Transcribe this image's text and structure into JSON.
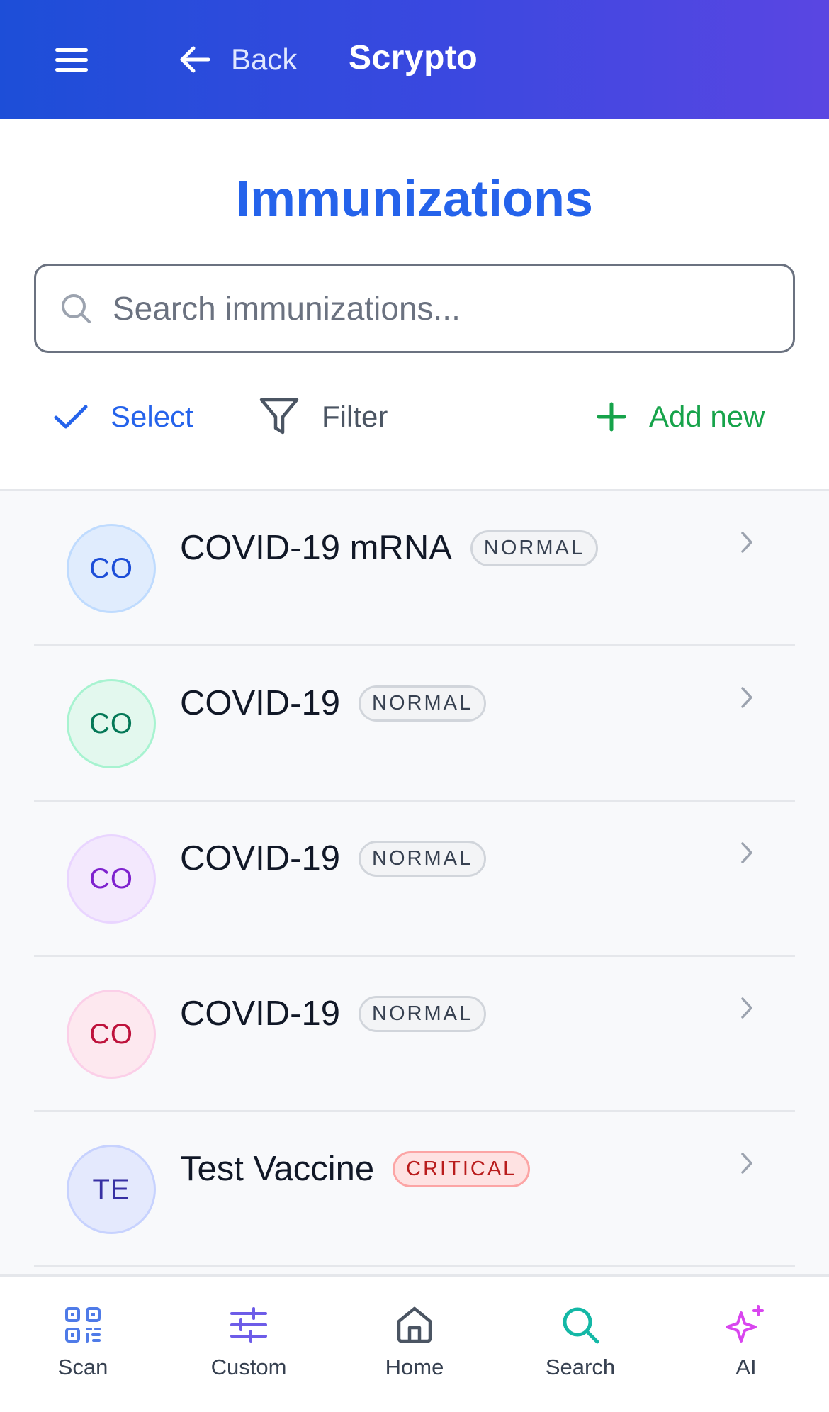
{
  "header": {
    "back_label": "Back",
    "app_title": "Scrypto"
  },
  "page": {
    "title": "Immunizations"
  },
  "search": {
    "placeholder": "Search immunizations..."
  },
  "toolbar": {
    "select_label": "Select",
    "filter_label": "Filter",
    "add_label": "Add new"
  },
  "colors": {
    "header_gradient_start": "#1d4ed8",
    "header_gradient_end": "#5a46e2",
    "title_blue": "#2563eb",
    "add_green": "#16a34a",
    "critical_red": "#b91c1c"
  },
  "immunizations": [
    {
      "initials": "CO",
      "name": "COVID-19 mRNA",
      "status": "NORMAL",
      "avatar_color": "#1d4ed8",
      "avatar_bg": "#e0ecfd",
      "avatar_border": "#bfdbfe"
    },
    {
      "initials": "CO",
      "name": "COVID-19",
      "status": "NORMAL",
      "avatar_color": "#047857",
      "avatar_bg": "#e3f8ee",
      "avatar_border": "#a7f3d0"
    },
    {
      "initials": "CO",
      "name": "COVID-19",
      "status": "NORMAL",
      "avatar_color": "#7e22ce",
      "avatar_bg": "#f3e8fd",
      "avatar_border": "#e9d5ff"
    },
    {
      "initials": "CO",
      "name": "COVID-19",
      "status": "NORMAL",
      "avatar_color": "#be123c",
      "avatar_bg": "#fde8ef",
      "avatar_border": "#fbcfe8"
    },
    {
      "initials": "TE",
      "name": "Test Vaccine",
      "status": "CRITICAL",
      "avatar_color": "#3730a3",
      "avatar_bg": "#e4e9fd",
      "avatar_border": "#c7d2fe"
    }
  ],
  "bottom_nav": {
    "scan": "Scan",
    "custom": "Custom",
    "home": "Home",
    "search": "Search",
    "ai": "AI"
  }
}
